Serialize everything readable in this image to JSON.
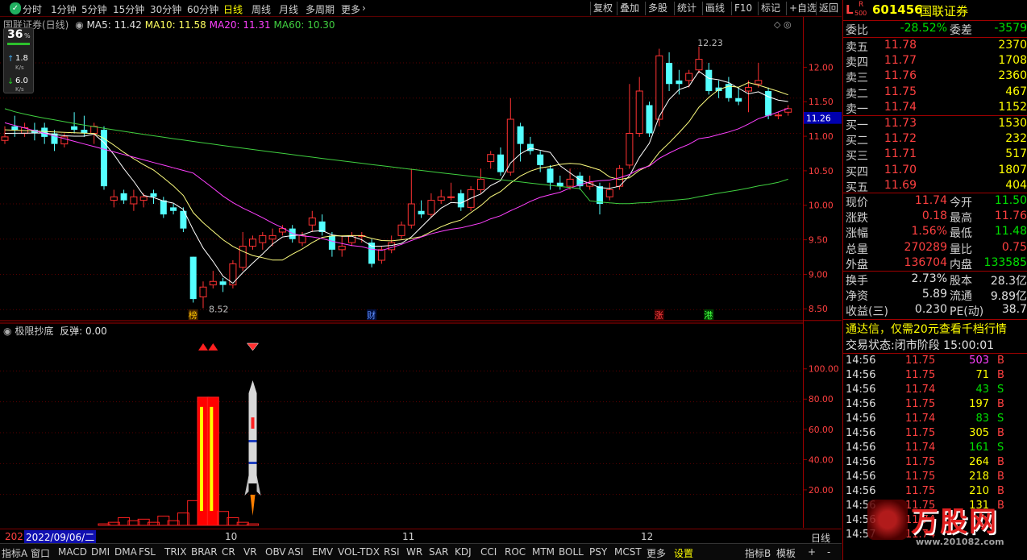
{
  "period_tabs": [
    "分时",
    "1分钟",
    "5分钟",
    "15分钟",
    "30分钟",
    "60分钟",
    "日线",
    "周线",
    "月线",
    "多周期",
    "更多"
  ],
  "active_period": "日线",
  "right_buttons": [
    "复权",
    "叠加",
    "多股",
    "统计",
    "画线",
    "F10",
    "标记",
    "+自选",
    "返回"
  ],
  "badge": {
    "num": "36",
    "pct": "%",
    "up_val": "1.8",
    "up_unit": "K/s",
    "down_val": "6.0",
    "down_unit": "K/s"
  },
  "chart_title": {
    "name": "国联证券(日线)",
    "ma5": "MA5: 11.42",
    "ma10": "MA10: 11.58",
    "ma20": "MA20: 11.31",
    "ma60": "MA60: 10.30"
  },
  "y_ticks": [
    "12.00",
    "11.50",
    "11.00",
    "10.50",
    "10.00",
    "9.50",
    "9.00",
    "8.50"
  ],
  "current_price_tag": "11.26",
  "high_marker": "12.23",
  "low_marker": "8.52",
  "event_markers": [
    "榜",
    "财",
    "涨",
    "港"
  ],
  "indicator_title": {
    "name": "极限抄底",
    "label": "反弹:",
    "value": "0.00"
  },
  "sub_y_ticks": [
    "100.00",
    "80.00",
    "60.00",
    "40.00",
    "20.00"
  ],
  "date_strip": {
    "year_prefix": "202",
    "date": "2022/09/06/二",
    "m10": "10",
    "m11": "11",
    "m12": "12",
    "right": "日线"
  },
  "bottom_tabs": [
    "指标A",
    "窗口",
    "MACD",
    "DMI",
    "DMA",
    "FSL",
    "TRIX",
    "BRAR",
    "CR",
    "VR",
    "OBV",
    "ASI",
    "EMV",
    "VOL-TDX",
    "RSI",
    "WR",
    "SAR",
    "KDJ",
    "CCI",
    "ROC",
    "MTM",
    "BOLL",
    "PSY",
    "MCST",
    "更多",
    "设置",
    "指标B",
    "模板"
  ],
  "stock": {
    "code": "601456",
    "name": "国联证券",
    "L": "L",
    "R": "R",
    "r500": "500"
  },
  "weibi": {
    "label": "委比",
    "value": "-28.52%",
    "label2": "委差",
    "value2": "-3579"
  },
  "asks": [
    {
      "label": "卖五",
      "price": "11.78",
      "vol": "2370"
    },
    {
      "label": "卖四",
      "price": "11.77",
      "vol": "1708"
    },
    {
      "label": "卖三",
      "price": "11.76",
      "vol": "2360"
    },
    {
      "label": "卖二",
      "price": "11.75",
      "vol": "467"
    },
    {
      "label": "卖一",
      "price": "11.74",
      "vol": "1152"
    }
  ],
  "bids": [
    {
      "label": "买一",
      "price": "11.73",
      "vol": "1530"
    },
    {
      "label": "买二",
      "price": "11.72",
      "vol": "232"
    },
    {
      "label": "买三",
      "price": "11.71",
      "vol": "517"
    },
    {
      "label": "买四",
      "price": "11.70",
      "vol": "1807"
    },
    {
      "label": "买五",
      "price": "11.69",
      "vol": "404"
    }
  ],
  "stats1": [
    {
      "l1": "现价",
      "v1": "11.74",
      "l2": "今开",
      "v2": "11.50"
    },
    {
      "l1": "涨跌",
      "v1": "0.18",
      "l2": "最高",
      "v2": "11.76"
    },
    {
      "l1": "涨幅",
      "v1": "1.56%",
      "l2": "最低",
      "v2": "11.48"
    },
    {
      "l1": "总量",
      "v1": "270289",
      "l2": "量比",
      "v2": "0.75"
    },
    {
      "l1": "外盘",
      "v1": "136704",
      "l2": "内盘",
      "v2": "133585"
    }
  ],
  "stats2": [
    {
      "l1": "换手",
      "v1": "2.73%",
      "l2": "股本",
      "v2": "28.3亿"
    },
    {
      "l1": "净资",
      "v1": "5.89",
      "l2": "流通",
      "v2": "9.89亿"
    },
    {
      "l1": "收益(三)",
      "v1": "0.230",
      "l2": "PE(动)",
      "v2": "38.7"
    }
  ],
  "promo": "通达信，仅需20元查看千档行情",
  "trade_status": "交易状态:闭市阶段 15:00:01",
  "ticks": [
    {
      "t": "14:56",
      "p": "11.75",
      "v": "503",
      "s": "B"
    },
    {
      "t": "14:56",
      "p": "11.75",
      "v": "71",
      "s": "B"
    },
    {
      "t": "14:56",
      "p": "11.74",
      "v": "43",
      "s": "S"
    },
    {
      "t": "14:56",
      "p": "11.75",
      "v": "197",
      "s": "B"
    },
    {
      "t": "14:56",
      "p": "11.74",
      "v": "83",
      "s": "S"
    },
    {
      "t": "14:56",
      "p": "11.75",
      "v": "305",
      "s": "B"
    },
    {
      "t": "14:56",
      "p": "11.74",
      "v": "161",
      "s": "S"
    },
    {
      "t": "14:56",
      "p": "11.75",
      "v": "264",
      "s": "B"
    },
    {
      "t": "14:56",
      "p": "11.75",
      "v": "218",
      "s": "B"
    },
    {
      "t": "14:56",
      "p": "11.75",
      "v": "210",
      "s": "B"
    },
    {
      "t": "14:56",
      "p": "11.75",
      "v": "131",
      "s": "B"
    },
    {
      "t": "14:56",
      "p": "11.74",
      "v": "",
      "s": ""
    },
    {
      "t": "14:57",
      "p": "11.74",
      "v": "",
      "s": ""
    }
  ],
  "watermark": {
    "brand": "万股网",
    "url": "www.201082.com"
  },
  "chart_data": {
    "type": "candlestick",
    "ylim": [
      8.4,
      12.4
    ],
    "candles": [
      {
        "o": 10.9,
        "c": 10.95,
        "h": 11.1,
        "l": 10.85
      },
      {
        "o": 11.1,
        "c": 11.05,
        "h": 11.25,
        "l": 10.95
      },
      {
        "o": 11.0,
        "c": 11.08,
        "h": 11.15,
        "l": 10.95
      },
      {
        "o": 11.05,
        "c": 11.0,
        "h": 11.15,
        "l": 10.9
      },
      {
        "o": 11.08,
        "c": 10.95,
        "h": 11.15,
        "l": 10.85
      },
      {
        "o": 11.0,
        "c": 10.85,
        "h": 11.05,
        "l": 10.75
      },
      {
        "o": 10.85,
        "c": 10.95,
        "h": 11.0,
        "l": 10.8
      },
      {
        "o": 11.1,
        "c": 11.05,
        "h": 11.3,
        "l": 11.0
      },
      {
        "o": 11.05,
        "c": 11.0,
        "h": 11.25,
        "l": 10.95
      },
      {
        "o": 11.0,
        "c": 11.1,
        "h": 11.15,
        "l": 10.85
      },
      {
        "o": 11.05,
        "c": 10.25,
        "h": 11.1,
        "l": 10.2
      },
      {
        "o": 10.05,
        "c": 10.1,
        "h": 10.2,
        "l": 9.95
      },
      {
        "o": 10.15,
        "c": 10.05,
        "h": 10.2,
        "l": 10.0
      },
      {
        "o": 10.0,
        "c": 10.1,
        "h": 10.2,
        "l": 9.9
      },
      {
        "o": 10.05,
        "c": 10.1,
        "h": 10.15,
        "l": 9.95
      },
      {
        "o": 10.15,
        "c": 10.1,
        "h": 10.2,
        "l": 10.0
      },
      {
        "o": 10.05,
        "c": 9.85,
        "h": 10.1,
        "l": 9.8
      },
      {
        "o": 9.95,
        "c": 9.9,
        "h": 10.0,
        "l": 9.85
      },
      {
        "o": 9.9,
        "c": 9.65,
        "h": 9.95,
        "l": 9.6
      },
      {
        "o": 9.25,
        "c": 8.65,
        "h": 9.25,
        "l": 8.6
      },
      {
        "o": 8.68,
        "c": 8.82,
        "h": 8.9,
        "l": 8.52
      },
      {
        "o": 8.85,
        "c": 8.9,
        "h": 9.05,
        "l": 8.8
      },
      {
        "o": 8.9,
        "c": 8.85,
        "h": 8.95,
        "l": 8.75
      },
      {
        "o": 8.85,
        "c": 9.15,
        "h": 9.2,
        "l": 8.8
      },
      {
        "o": 9.1,
        "c": 9.4,
        "h": 9.6,
        "l": 9.05
      },
      {
        "o": 9.4,
        "c": 9.5,
        "h": 9.55,
        "l": 9.35
      },
      {
        "o": 9.45,
        "c": 9.55,
        "h": 9.6,
        "l": 9.35
      },
      {
        "o": 9.5,
        "c": 9.55,
        "h": 9.65,
        "l": 9.4
      },
      {
        "o": 9.6,
        "c": 9.65,
        "h": 9.7,
        "l": 9.55
      },
      {
        "o": 9.65,
        "c": 9.5,
        "h": 9.7,
        "l": 9.45
      },
      {
        "o": 9.45,
        "c": 9.55,
        "h": 9.6,
        "l": 9.4
      },
      {
        "o": 9.7,
        "c": 9.8,
        "h": 9.9,
        "l": 9.6
      },
      {
        "o": 9.75,
        "c": 9.6,
        "h": 9.85,
        "l": 9.55
      },
      {
        "o": 9.55,
        "c": 9.35,
        "h": 9.6,
        "l": 9.25
      },
      {
        "o": 9.35,
        "c": 9.4,
        "h": 9.55,
        "l": 9.25
      },
      {
        "o": 9.45,
        "c": 9.55,
        "h": 9.6,
        "l": 9.4
      },
      {
        "o": 9.55,
        "c": 9.55,
        "h": 9.6,
        "l": 9.45
      },
      {
        "o": 9.45,
        "c": 9.15,
        "h": 9.5,
        "l": 9.1
      },
      {
        "o": 9.2,
        "c": 9.35,
        "h": 9.4,
        "l": 9.15
      },
      {
        "o": 9.35,
        "c": 9.45,
        "h": 9.55,
        "l": 9.3
      },
      {
        "o": 9.55,
        "c": 9.7,
        "h": 9.75,
        "l": 9.5
      },
      {
        "o": 9.7,
        "c": 10.0,
        "h": 10.5,
        "l": 9.65
      },
      {
        "o": 9.9,
        "c": 9.85,
        "h": 10.05,
        "l": 9.8
      },
      {
        "o": 9.85,
        "c": 10.05,
        "h": 10.15,
        "l": 9.8
      },
      {
        "o": 10.05,
        "c": 10.1,
        "h": 10.2,
        "l": 10.0
      },
      {
        "o": 10.1,
        "c": 10.1,
        "h": 10.3,
        "l": 10.05
      },
      {
        "o": 10.15,
        "c": 9.95,
        "h": 10.2,
        "l": 9.9
      },
      {
        "o": 9.95,
        "c": 10.2,
        "h": 10.25,
        "l": 9.9
      },
      {
        "o": 10.2,
        "c": 10.35,
        "h": 10.5,
        "l": 10.15
      },
      {
        "o": 10.6,
        "c": 10.7,
        "h": 10.75,
        "l": 10.5
      },
      {
        "o": 10.7,
        "c": 10.45,
        "h": 10.8,
        "l": 10.4
      },
      {
        "o": 10.45,
        "c": 11.2,
        "h": 11.5,
        "l": 10.4
      },
      {
        "o": 11.1,
        "c": 10.85,
        "h": 11.15,
        "l": 10.6
      },
      {
        "o": 10.85,
        "c": 10.75,
        "h": 10.95,
        "l": 10.7
      },
      {
        "o": 10.7,
        "c": 10.55,
        "h": 10.75,
        "l": 10.45
      },
      {
        "o": 10.5,
        "c": 10.3,
        "h": 10.55,
        "l": 10.2
      },
      {
        "o": 10.3,
        "c": 10.25,
        "h": 10.4,
        "l": 10.2
      },
      {
        "o": 10.25,
        "c": 10.35,
        "h": 10.5,
        "l": 10.2
      },
      {
        "o": 10.4,
        "c": 10.25,
        "h": 10.45,
        "l": 10.2
      },
      {
        "o": 10.25,
        "c": 10.3,
        "h": 10.4,
        "l": 10.2
      },
      {
        "o": 10.25,
        "c": 10.0,
        "h": 10.3,
        "l": 9.85
      },
      {
        "o": 10.1,
        "c": 10.2,
        "h": 10.3,
        "l": 10.05
      },
      {
        "o": 10.25,
        "c": 10.5,
        "h": 10.55,
        "l": 10.2
      },
      {
        "o": 10.55,
        "c": 11.0,
        "h": 11.7,
        "l": 10.5
      },
      {
        "o": 11.0,
        "c": 11.6,
        "h": 11.8,
        "l": 10.95
      },
      {
        "o": 11.4,
        "c": 11.0,
        "h": 11.45,
        "l": 10.95
      },
      {
        "o": 11.2,
        "c": 12.1,
        "h": 12.2,
        "l": 11.1
      },
      {
        "o": 12.0,
        "c": 11.7,
        "h": 12.15,
        "l": 11.6
      },
      {
        "o": 11.75,
        "c": 11.7,
        "h": 11.9,
        "l": 11.55
      },
      {
        "o": 11.75,
        "c": 11.85,
        "h": 11.9,
        "l": 11.65
      },
      {
        "o": 11.9,
        "c": 12.05,
        "h": 12.23,
        "l": 11.85
      },
      {
        "o": 11.9,
        "c": 11.6,
        "h": 12.0,
        "l": 11.55
      },
      {
        "o": 11.65,
        "c": 11.6,
        "h": 11.75,
        "l": 11.5
      },
      {
        "o": 11.7,
        "c": 11.5,
        "h": 11.8,
        "l": 11.45
      },
      {
        "o": 11.5,
        "c": 11.45,
        "h": 11.65,
        "l": 11.4
      },
      {
        "o": 11.6,
        "c": 11.65,
        "h": 11.75,
        "l": 11.3
      },
      {
        "o": 11.7,
        "c": 11.75,
        "h": 12.0,
        "l": 11.65
      },
      {
        "o": 11.6,
        "c": 11.25,
        "h": 11.65,
        "l": 11.2
      },
      {
        "o": 11.25,
        "c": 11.26,
        "h": 11.3,
        "l": 11.2
      },
      {
        "o": 11.3,
        "c": 11.35,
        "h": 11.4,
        "l": 11.25
      }
    ],
    "ma_series": [
      {
        "name": "MA5",
        "color": "#ffffff"
      },
      {
        "name": "MA10",
        "color": "#ffff80"
      },
      {
        "name": "MA20",
        "color": "#ff40ff"
      },
      {
        "name": "MA60",
        "color": "#40d040"
      }
    ],
    "indicator": {
      "ylim": [
        0,
        120
      ],
      "bars": [
        {
          "i": 10,
          "v": 1
        },
        {
          "i": 11,
          "v": 2
        },
        {
          "i": 12,
          "v": 5
        },
        {
          "i": 13,
          "v": 3
        },
        {
          "i": 14,
          "v": 4
        },
        {
          "i": 15,
          "v": 2
        },
        {
          "i": 16,
          "v": 6
        },
        {
          "i": 17,
          "v": 3
        },
        {
          "i": 18,
          "v": 8
        },
        {
          "i": 19,
          "v": 16
        },
        {
          "i": 20,
          "v": 83
        },
        {
          "i": 21,
          "v": 83
        },
        {
          "i": 22,
          "v": 9
        },
        {
          "i": 23,
          "v": 5
        },
        {
          "i": 24,
          "v": 2
        },
        {
          "i": 25,
          "v": 1
        }
      ]
    },
    "colors": {
      "up": "#ff3232",
      "down": "#54ffff",
      "grid": "#5a0000",
      "axis": "#a00000"
    }
  }
}
